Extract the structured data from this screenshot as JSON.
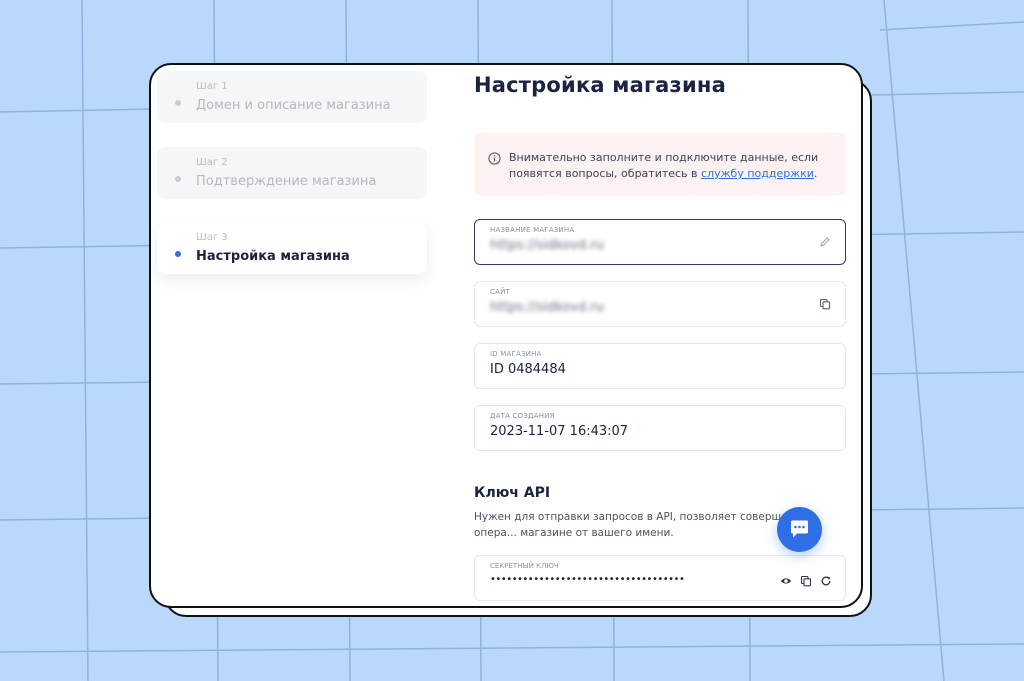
{
  "steps": [
    {
      "num": "Шаг 1",
      "label": "Домен и описание магазина",
      "active": false
    },
    {
      "num": "Шаг 2",
      "label": "Подтверждение магазина",
      "active": false
    },
    {
      "num": "Шаг 3",
      "label": "Настройка магазина",
      "active": true
    }
  ],
  "page": {
    "title": "Настройка магазина"
  },
  "notice": {
    "text": "Внимательно заполните и подключите данные, если появятся вопросы, обратитесь в ",
    "link": "службу поддержки",
    "tail": ".",
    "icon": "info-icon"
  },
  "fields": {
    "store_name": {
      "label": "НАЗВАНИЕ МАГАЗИНА",
      "value": "https://sidkovd.ru",
      "icon": "pencil-icon"
    },
    "site": {
      "label": "САЙТ",
      "value": "https://sidkovd.ru",
      "icon": "copy-icon"
    },
    "store_id": {
      "label": "ID МАГАЗИНА",
      "value": "ID 0484484"
    },
    "created": {
      "label": "ДАТА СОЗДАНИЯ",
      "value": "2023-11-07 16:43:07"
    }
  },
  "api": {
    "title": "Ключ API",
    "description": "Нужен для отправки запросов в API, позволяет совершать опера... магазине от вашего имени.",
    "key_label": "СЕКРЕТНЫЙ КЛЮЧ",
    "key_value": "••••••••••••••••••••••••••••••••••••"
  },
  "colors": {
    "accent": "#2f6fe6",
    "background": "#b9d8fb",
    "notice_bg": "#fdf1f1",
    "title": "#1c2340"
  },
  "chat": {
    "icon": "chat-icon"
  }
}
